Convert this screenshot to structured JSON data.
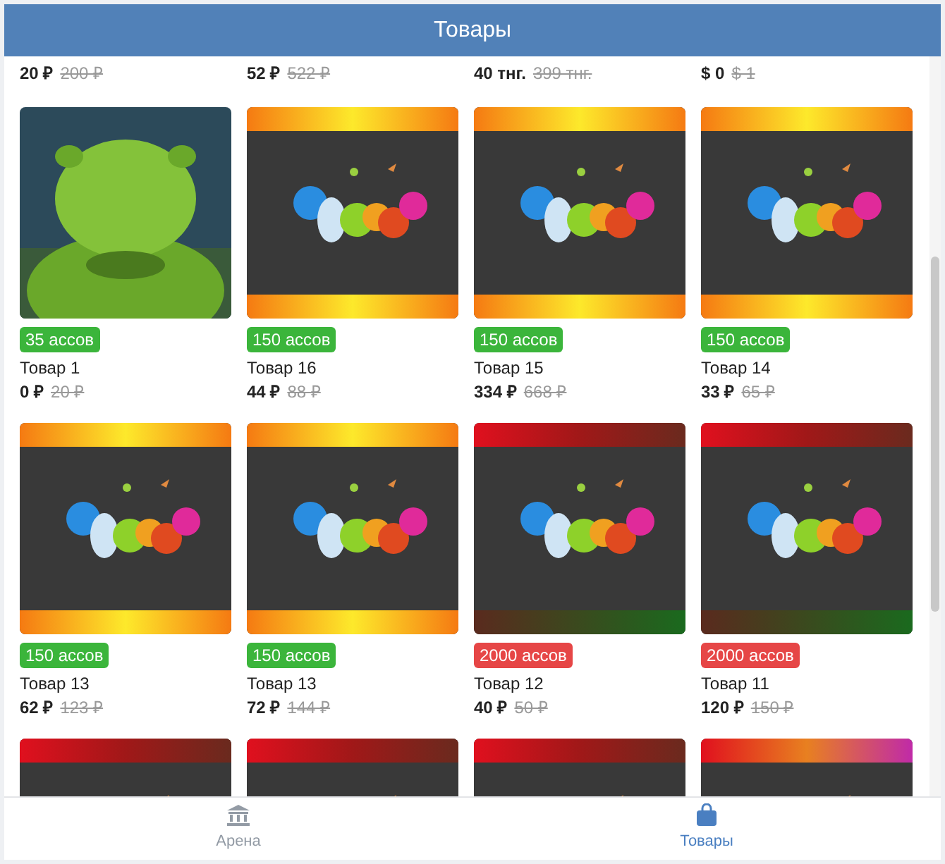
{
  "header": {
    "title": "Товары"
  },
  "products": [
    {
      "kind": "price_only",
      "price": "20 ₽",
      "old_price": "200 ₽"
    },
    {
      "kind": "price_only",
      "price": "52 ₽",
      "old_price": "522 ₽"
    },
    {
      "kind": "price_only",
      "price": "40 тнг.",
      "old_price": "399 тнг."
    },
    {
      "kind": "price_only",
      "price": "$ 0",
      "old_price": "$ 1"
    },
    {
      "kind": "full",
      "badge": "35 ассов",
      "color": "#3bb53b",
      "name": "Товар 1",
      "price": "0 ₽",
      "old_price": "20 ₽"
    },
    {
      "kind": "full",
      "badge": "150 ассов",
      "color": "#3bb53b",
      "name": "Товар 16",
      "price": "44 ₽",
      "old_price": "88 ₽"
    },
    {
      "kind": "full",
      "badge": "150 ассов",
      "color": "#3bb53b",
      "name": "Товар 15",
      "price": "334 ₽",
      "old_price": "668 ₽"
    },
    {
      "kind": "full",
      "badge": "150 ассов",
      "color": "#3bb53b",
      "name": "Товар 14",
      "price": "33 ₽",
      "old_price": "65 ₽"
    },
    {
      "kind": "full",
      "badge": "150 ассов",
      "color": "#3bb53b",
      "name": "Товар 13",
      "price": "62 ₽",
      "old_price": "123 ₽"
    },
    {
      "kind": "full",
      "badge": "150 ассов",
      "color": "#3bb53b",
      "name": "Товар 13",
      "price": "72 ₽",
      "old_price": "144 ₽"
    },
    {
      "kind": "full",
      "badge": "2000 ассов",
      "color": "#e64646",
      "name": "Товар 12",
      "price": "40 ₽",
      "old_price": "50 ₽"
    },
    {
      "kind": "full",
      "badge": "2000 ассов",
      "color": "#e64646",
      "name": "Товар 11",
      "price": "120 ₽",
      "old_price": "150 ₽"
    },
    {
      "kind": "picture_only"
    },
    {
      "kind": "picture_only"
    },
    {
      "kind": "picture_only"
    },
    {
      "kind": "picture_only"
    }
  ],
  "tabs": [
    {
      "label": "Арена",
      "kind": "arena",
      "selected": false
    },
    {
      "label": "Товары",
      "kind": "goods",
      "selected": true
    }
  ]
}
